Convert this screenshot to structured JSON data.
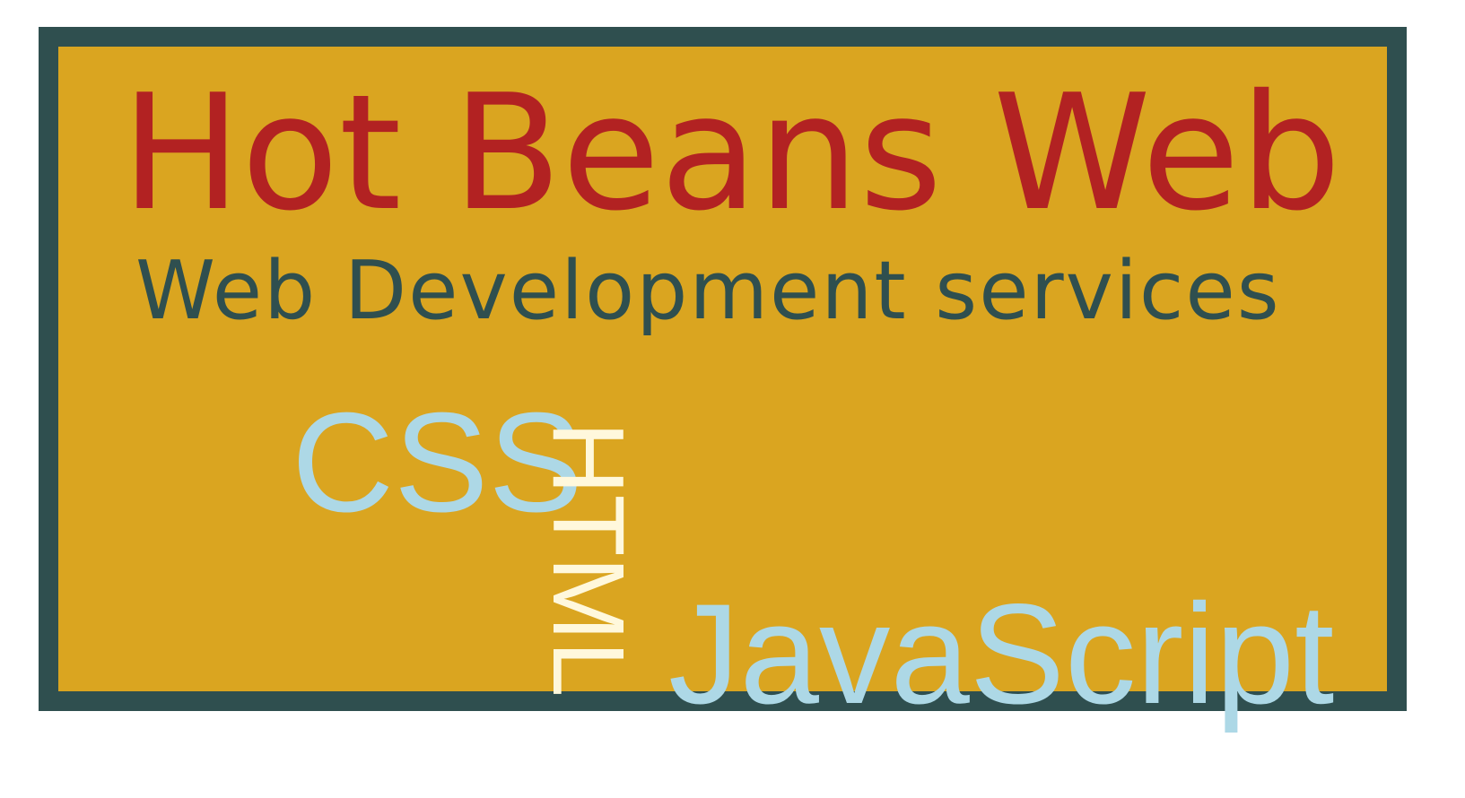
{
  "banner": {
    "title": "Hot Beans Web",
    "subtitle": "Web Development services",
    "words": {
      "css": "CSS",
      "html": "HTML",
      "javascript": "JavaScript"
    },
    "colors": {
      "background": "#daa520",
      "border": "#2f4f4f",
      "title": "#b22222",
      "subtitle": "#2f4f4f",
      "css": "#add8e6",
      "html": "#fff8dc",
      "javascript": "#add8e6"
    }
  }
}
